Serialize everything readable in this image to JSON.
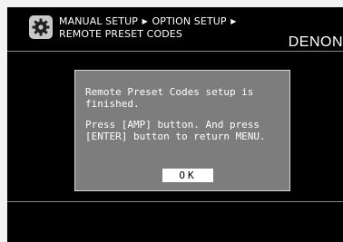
{
  "header": {
    "icon": "gear-icon",
    "breadcrumb_line1_part1": "MANUAL SETUP",
    "breadcrumb_line1_part2": "OPTION SETUP",
    "breadcrumb_line2": "REMOTE PRESET CODES",
    "separator": "▶",
    "brand": "DENON"
  },
  "dialog": {
    "message_line1": "Remote Preset Codes setup is finished.",
    "message_line2": "Press [AMP] button. And press [ENTER] button to return MENU.",
    "ok_label": "OK"
  },
  "colors": {
    "screen_background": "#000000",
    "dialog_background": "#7d7d7d",
    "text": "#ffffff",
    "button_background": "#ffffff"
  }
}
